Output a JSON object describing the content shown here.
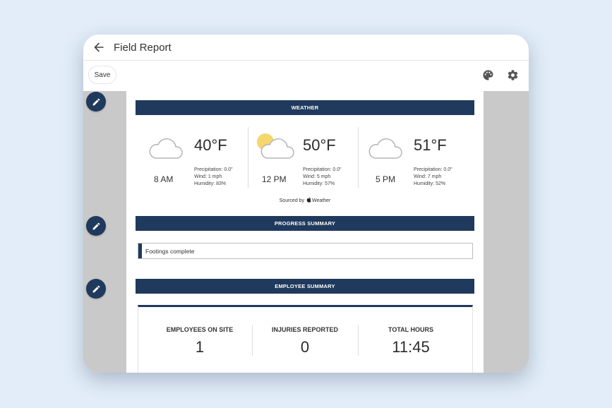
{
  "header": {
    "title": "Field Report"
  },
  "toolbar": {
    "save_label": "Save"
  },
  "weather": {
    "section_title": "WEATHER",
    "entries": [
      {
        "time": "8 AM",
        "temp": "40°F",
        "precipitation": "Precipitation: 0.0\"",
        "wind": "Wind: 1 mph",
        "humidity": "Humidity: 83%",
        "icon": "cloud-icon"
      },
      {
        "time": "12 PM",
        "temp": "50°F",
        "precipitation": "Precipitation: 0.0\"",
        "wind": "Wind: 5 mph",
        "humidity": "Humidity: 57%",
        "icon": "partly-sunny-icon"
      },
      {
        "time": "5 PM",
        "temp": "51°F",
        "precipitation": "Precipitation: 0.0\"",
        "wind": "Wind: 7 mph",
        "humidity": "Humidity: 52%",
        "icon": "cloud-icon"
      }
    ],
    "sourced_prefix": "Sourced by",
    "sourced_brand": "Weather"
  },
  "progress": {
    "section_title": "PROGRESS SUMMARY",
    "text": "Footings complete"
  },
  "employee": {
    "section_title": "EMPLOYEE SUMMARY",
    "stats": [
      {
        "label": "EMPLOYEES ON SITE",
        "value": "1"
      },
      {
        "label": "INJURIES REPORTED",
        "value": "0"
      },
      {
        "label": "TOTAL HOURS",
        "value": "11:45"
      }
    ]
  },
  "colors": {
    "page_background": "#e2edf9",
    "accent_navy": "#1f3a5c",
    "canvas_gray": "#c9c9c9",
    "sun_yellow": "#f5d76e"
  }
}
